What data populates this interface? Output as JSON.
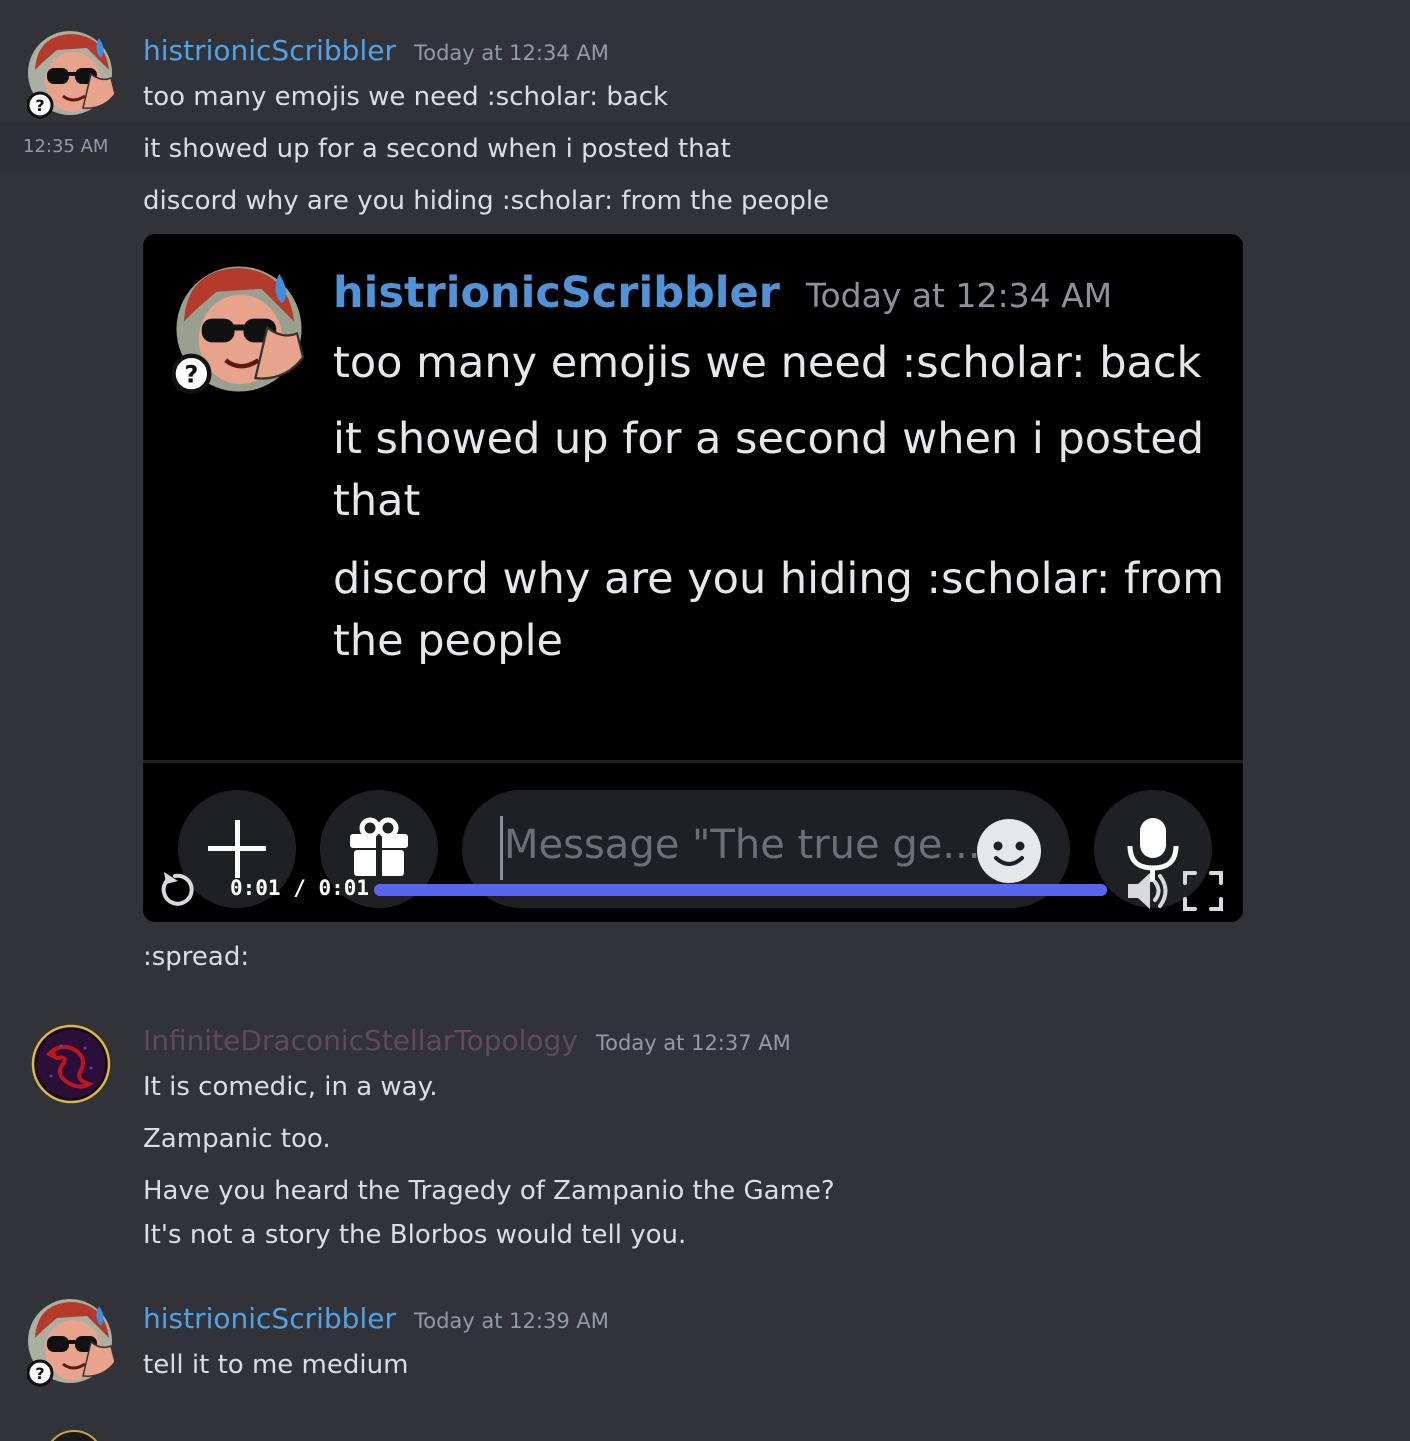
{
  "colors": {
    "background": "#313338",
    "username_blue": "#4fa3e8",
    "username_draconic": "#5e4b57",
    "progress_fill": "#5865f2"
  },
  "messages": [
    {
      "author": "histrionicScribbler",
      "timestamp": "Today at 12:34 AM",
      "lines": [
        "too many emojis we need :scholar: back"
      ]
    },
    {
      "side_timestamp": "12:35 AM",
      "lines": [
        "it showed up for a second when i posted that",
        "discord why are you hiding :scholar: from the people"
      ]
    },
    {
      "video": {
        "author": "histrionicScribbler",
        "timestamp": "Today at 12:34 AM",
        "lines": [
          "too many emojis we need :scholar: back",
          "it showed up for a second when i posted",
          "that",
          "discord why are you hiding :scholar: from",
          "the people"
        ],
        "input_placeholder": "Message \"The true ge...",
        "time_display": "0:01 / 0:01",
        "progress": 1.0
      },
      "after_text": ":spread:"
    },
    {
      "author": "InfiniteDraconicStellarTopology",
      "timestamp": "Today at 12:37 AM",
      "lines": [
        "It is comedic, in a way.",
        "Zampanic too.",
        "Have you heard the Tragedy of Zampanio the Game?",
        "It's not a story the Blorbos would tell you."
      ]
    },
    {
      "author": "histrionicScribbler",
      "timestamp": "Today at 12:39 AM",
      "lines": [
        "tell it to me medium"
      ]
    }
  ]
}
